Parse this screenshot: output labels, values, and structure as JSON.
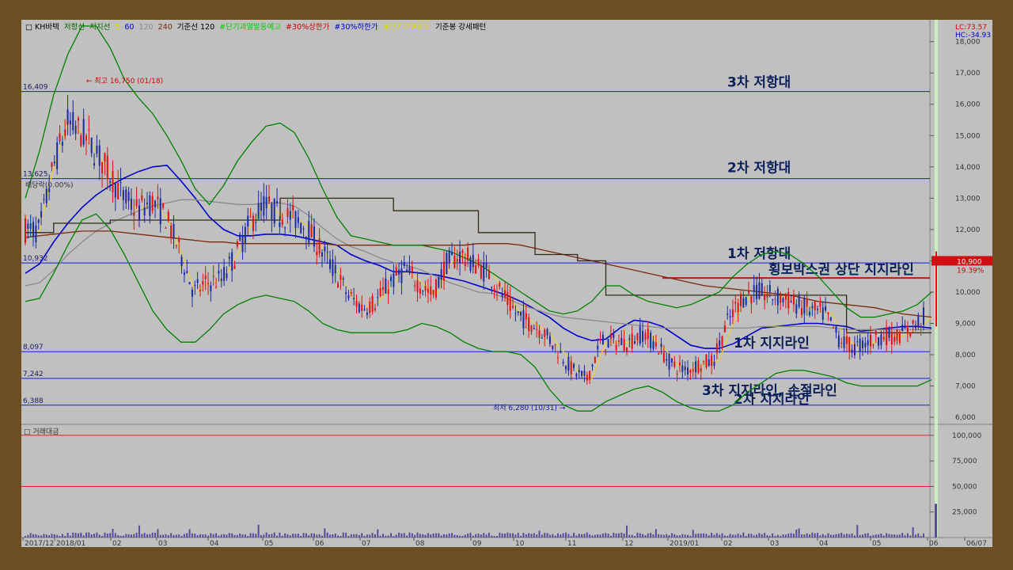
{
  "header": {
    "items": [
      {
        "text": "□ KH바텍",
        "color": "#000000"
      },
      {
        "text": "저항선",
        "color": "#006600"
      },
      {
        "text": "지지선",
        "color": "#006600"
      },
      {
        "text": "5",
        "color": "#d8d800"
      },
      {
        "text": "60",
        "color": "#0000cc"
      },
      {
        "text": "120",
        "color": "#888888"
      },
      {
        "text": "240",
        "color": "#7a2a10"
      },
      {
        "text": "기준선 120",
        "color": "#000000"
      },
      {
        "text": "#단기과열발동예고",
        "color": "#00cc00"
      },
      {
        "text": "#30%상한가",
        "color": "#cc0000"
      },
      {
        "text": "#30%하한가",
        "color": "#0000cc"
      },
      {
        "text": "#단기과열적용",
        "color": "#d8d800"
      },
      {
        "text": "기준봉 강세패턴",
        "color": "#000000"
      }
    ],
    "lc": "LC:73.57",
    "hc": "HC:-34.93"
  },
  "volume_panel_title": "□ 거래대금",
  "chart_data": [
    {
      "type": "candlestick",
      "title": "KH바텍",
      "ylim": [
        5800,
        18700
      ],
      "y_ticks": [
        "18,000",
        "17,000",
        "16,000",
        "15,000",
        "14,000",
        "13,000",
        "12,000",
        "11,000",
        "10,000",
        "9,000",
        "8,000",
        "7,000",
        "6,000"
      ],
      "x_ticks": [
        "2017/12",
        "2018/01",
        "02",
        "03",
        "04",
        "05",
        "06",
        "07",
        "08",
        "09",
        "10",
        "11",
        "12",
        "2019/01",
        "02",
        "03",
        "04",
        "05",
        "06",
        "06/07"
      ],
      "grid": false,
      "horizontal_levels": [
        {
          "value": 16409,
          "label": "16,409",
          "annotation": "3차 저항대"
        },
        {
          "value": 13625,
          "label": "13,625",
          "annotation": "2차 저항대"
        },
        {
          "value": 10932,
          "label": "10,932",
          "annotation": "1차 저항대"
        },
        {
          "value": 8097,
          "label": "8,097",
          "annotation": "1차 지지라인"
        },
        {
          "value": 7242,
          "label": "7,242",
          "annotation": "2차 지지라인"
        },
        {
          "value": 6388,
          "label": "6,388",
          "annotation": "3차 지지라인, 손절라인"
        }
      ],
      "box_top_line": {
        "value": 10450,
        "annotation": "횡보박스권 상단 지지라인"
      },
      "markers": [
        {
          "text": "최고 16,750 (01/18)",
          "value": 16750
        },
        {
          "text": "최저 6,280 (10/31)",
          "value": 6280
        },
        {
          "text": "배당락(0.00%)",
          "value": 13400
        }
      ],
      "price_badge": {
        "value": "10,900",
        "change": "19.39%"
      },
      "series": [
        {
          "name": "5",
          "color": "#e8d040",
          "values": [
            12000,
            11950,
            14000,
            15400,
            15100,
            14500,
            13800,
            13000,
            12600,
            12900,
            12400,
            11300,
            10000,
            10300,
            10400,
            11200,
            12200,
            12800,
            12500,
            12400,
            12100,
            11400,
            10700,
            9900,
            9500,
            9700,
            10300,
            10700,
            10300,
            9900,
            10900,
            11200,
            10900,
            10600,
            9900,
            9300,
            9000,
            8700,
            8100,
            7500,
            7200,
            8400,
            8400,
            8400,
            8700,
            8300,
            7700,
            7500,
            7700,
            7800,
            9000,
            9800,
            10000,
            9900,
            9800,
            9600,
            9400,
            9300,
            8500,
            8200,
            8400,
            8600,
            8600,
            8800,
            9200
          ]
        },
        {
          "name": "60",
          "color": "#0000cc",
          "values": [
            10600,
            10900,
            11600,
            12200,
            12700,
            13100,
            13400,
            13650,
            13850,
            14000,
            14050,
            13550,
            13000,
            12400,
            12000,
            11800,
            11800,
            11850,
            11850,
            11800,
            11700,
            11600,
            11500,
            11200,
            11000,
            10850,
            10650,
            10650,
            10600,
            10550,
            10450,
            10350,
            10200,
            10050,
            9900,
            9700,
            9450,
            9200,
            8850,
            8600,
            8450,
            8500,
            8850,
            9100,
            9050,
            8900,
            8600,
            8300,
            8200,
            8200,
            8350,
            8600,
            8850,
            8900,
            8950,
            9000,
            9000,
            8950,
            8900,
            8750,
            8800,
            8850,
            8900,
            8900,
            8850
          ]
        },
        {
          "name": "120",
          "color": "#8a8a8a",
          "values": [
            10200,
            10300,
            10700,
            11200,
            11600,
            11950,
            12200,
            12400,
            12600,
            12750,
            12850,
            12950,
            12950,
            12900,
            12850,
            12800,
            12800,
            12850,
            12850,
            12750,
            12450,
            12050,
            11700,
            11450,
            11300,
            11100,
            10950,
            10850,
            10700,
            10500,
            10300,
            10150,
            10000,
            9950,
            9800,
            9600,
            9450,
            9300,
            9200,
            9150,
            9100,
            9050,
            9000,
            8950,
            8900,
            8850,
            8850,
            8850,
            8850,
            8850,
            8850,
            8850,
            8900,
            8900,
            8900,
            8900,
            8900,
            8850,
            8800,
            8800,
            8800,
            8800,
            8800,
            8800,
            8800
          ]
        },
        {
          "name": "240",
          "color": "#7a2a10",
          "values": [
            11750,
            11800,
            11850,
            11900,
            11950,
            11950,
            11950,
            11900,
            11850,
            11800,
            11750,
            11700,
            11650,
            11600,
            11600,
            11550,
            11550,
            11550,
            11550,
            11550,
            11550,
            11550,
            11500,
            11500,
            11500,
            11500,
            11500,
            11500,
            11500,
            11500,
            11500,
            11500,
            11550,
            11550,
            11550,
            11500,
            11400,
            11300,
            11200,
            11100,
            11000,
            10900,
            10800,
            10700,
            10600,
            10500,
            10400,
            10300,
            10200,
            10150,
            10100,
            10050,
            10000,
            9950,
            9900,
            9800,
            9700,
            9650,
            9600,
            9550,
            9500,
            9400,
            9300,
            9250,
            9200
          ]
        },
        {
          "name": "기준선 120",
          "color": "#33281a",
          "values": [
            11900,
            11900,
            12200,
            12200,
            12200,
            12200,
            12300,
            12300,
            12300,
            12300,
            12300,
            12300,
            12300,
            12300,
            12300,
            12300,
            12300,
            12300,
            13000,
            13000,
            13000,
            13000,
            13000,
            13000,
            13000,
            13000,
            12600,
            12600,
            12600,
            12600,
            12600,
            12600,
            11900,
            11900,
            11900,
            11900,
            11200,
            11200,
            11200,
            11000,
            11000,
            9900,
            9900,
            9900,
            9900,
            9900,
            9900,
            9900,
            9900,
            9900,
            9900,
            9900,
            9900,
            9900,
            9900,
            9900,
            9900,
            9900,
            8700,
            8700,
            8700,
            8700,
            8700,
            8700,
            8700
          ]
        },
        {
          "name": "저항선",
          "color": "#008000",
          "values": [
            13000,
            14500,
            16300,
            17600,
            18500,
            18500,
            17800,
            16800,
            16200,
            15700,
            15000,
            14200,
            13300,
            12800,
            13400,
            14200,
            14800,
            15300,
            15400,
            15100,
            14300,
            13300,
            12400,
            11800,
            11700,
            11600,
            11500,
            11500,
            11500,
            11400,
            11300,
            11100,
            10900,
            10600,
            10300,
            10000,
            9700,
            9400,
            9300,
            9400,
            9700,
            10200,
            10200,
            9900,
            9700,
            9600,
            9500,
            9600,
            9800,
            10000,
            10500,
            10900,
            11200,
            11300,
            11200,
            10900,
            10500,
            10000,
            9500,
            9200,
            9200,
            9300,
            9400,
            9600,
            10000
          ]
        },
        {
          "name": "지지선",
          "color": "#008000",
          "values": [
            9700,
            9800,
            10600,
            11500,
            12300,
            12500,
            12000,
            11200,
            10300,
            9400,
            8800,
            8400,
            8400,
            8800,
            9300,
            9600,
            9800,
            9900,
            9800,
            9700,
            9400,
            9000,
            8800,
            8700,
            8700,
            8700,
            8700,
            8800,
            9000,
            8900,
            8700,
            8400,
            8200,
            8100,
            8100,
            8000,
            7600,
            6900,
            6400,
            6200,
            6200,
            6500,
            6700,
            6900,
            7000,
            6800,
            6500,
            6300,
            6200,
            6200,
            6400,
            6800,
            7100,
            7400,
            7500,
            7500,
            7400,
            7300,
            7100,
            7000,
            7000,
            7000,
            7000,
            7000,
            7200
          ]
        }
      ]
    },
    {
      "type": "bar",
      "title": "거래대금",
      "ylim": [
        0,
        110000
      ],
      "y_ticks": [
        "100,000",
        "75,000",
        "50,000",
        "25,000"
      ],
      "reference_lines": [
        100000,
        50000
      ]
    }
  ]
}
